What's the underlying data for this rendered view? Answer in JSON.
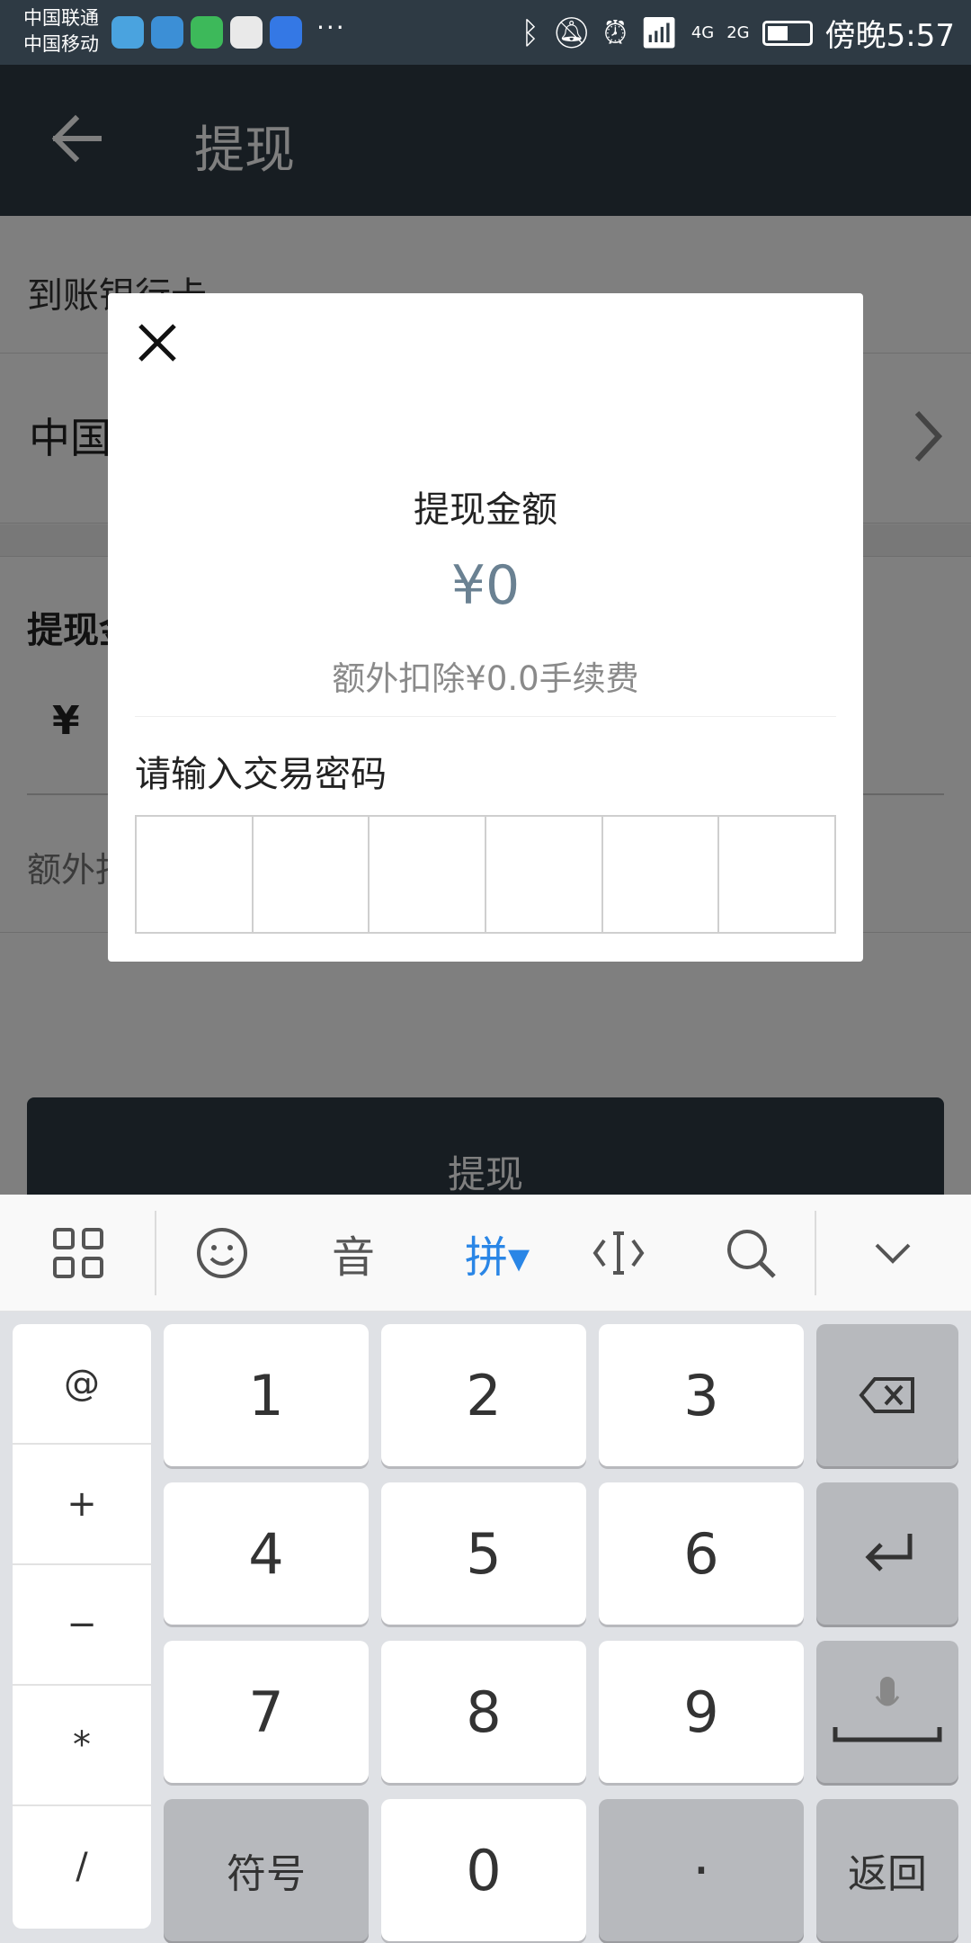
{
  "status_bar": {
    "carrier_1": "中国联通",
    "carrier_2": "中国移动",
    "more": "···",
    "network_4g": "4G",
    "network_2g": "2G",
    "time": "傍晚5:57"
  },
  "app_bar": {
    "title": "提现"
  },
  "page": {
    "section_label": "到账银行卡",
    "bank_name": "中国",
    "amount_label": "提现金",
    "currency_symbol": "¥",
    "fee_text": "额外扣",
    "submit_label": "提现"
  },
  "dialog": {
    "title": "提现金额",
    "amount": "¥0",
    "fee_note": "额外扣除¥0.0手续费",
    "password_prompt": "请输入交易密码",
    "password_length": 6
  },
  "keyboard_toolbar": {
    "voice_label": "音",
    "pinyin_label": "拼▾",
    "accent_color": "#2a86e6"
  },
  "keyboard": {
    "side_keys": [
      "@",
      "+",
      "−",
      "*",
      "/"
    ],
    "digits_row1": [
      "1",
      "2",
      "3"
    ],
    "digits_row2": [
      "4",
      "5",
      "6"
    ],
    "digits_row3": [
      "7",
      "8",
      "9"
    ],
    "symbol_key": "符号",
    "zero_key": "0",
    "dot_key": "·",
    "return_key": "返回"
  },
  "colors": {
    "app_bar": "#2e3a44",
    "amount_text": "#6a8192"
  }
}
